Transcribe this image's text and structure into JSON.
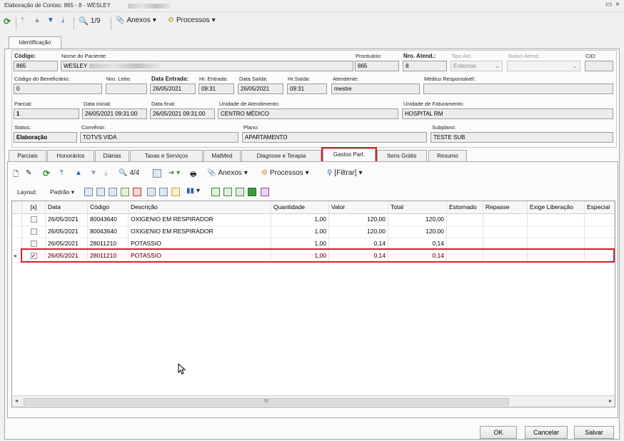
{
  "window": {
    "title": "Elaboração de Contas: 865 - 8 - WESLEY",
    "minimize": "▭",
    "close": "×"
  },
  "toolbar": {
    "record_pos": "1/9",
    "anexos": "Anexos",
    "processos": "Processos"
  },
  "outer_tab": "Identificação",
  "form": {
    "codigo_label": "Código:",
    "codigo": "865",
    "paciente_label": "Nome do Paciente:",
    "paciente": "WESLEY",
    "prontuario_label": "Prontuário:",
    "prontuario": "865",
    "nro_atend_label": "Nro. Atend.:",
    "nro_atend": "8",
    "tipo_atd_label": "Tipo Atd.:",
    "tipo_atd": "Externos",
    "status_atend_label": "Status Atend.:",
    "status_atend": "",
    "cid_label": "CID:",
    "cid": "",
    "cod_benef_label": "Código do Beneficiário:",
    "cod_benef": "0",
    "nro_leito_label": "Nro. Leito:",
    "nro_leito": "",
    "data_entrada_label": "Data Entrada:",
    "data_entrada": "26/05/2021",
    "hr_entrada_label": "Hr. Entrada:",
    "hr_entrada": "09:31",
    "data_saida_label": "Data Saída:",
    "data_saida": "26/05/2021",
    "hr_saida_label": "Hr.Saída:",
    "hr_saida": "09:31",
    "atendente_label": "Atendente:",
    "atendente": "mestre",
    "medico_label": "Médico Responsável:",
    "medico": "",
    "parcial_label": "Parcial:",
    "parcial": "1",
    "data_inicial_label": "Data inicial:",
    "data_inicial": "26/05/2021 09:31:00",
    "data_final_label": "Data final:",
    "data_final": "26/05/2021 09:31:00",
    "unid_atend_label": "Unidade de Atendimento:",
    "unid_atend": "CENTRO MÉDICO",
    "unid_fat_label": "Unidade de Faturamento:",
    "unid_fat": "HOSPITAL RM",
    "status_label": "Status:",
    "status": "Elaboração",
    "convenio_label": "Convênio:",
    "convenio": "TOTVS VIDA",
    "plano_label": "Plano:",
    "plano": "APARTAMENTO",
    "subplano_label": "Subplano:",
    "subplano": "TESTE SUB"
  },
  "tabs": [
    "Parciais",
    "Honorários",
    "Diárias",
    "Taxas e Serviços",
    "MatMed",
    "Diagnose e Terapia",
    "Gastos Part.",
    "Itens Grátis",
    "Resumo"
  ],
  "active_tab": "Gastos Part.",
  "inner_toolbar": {
    "record_pos": "4/4",
    "anexos": "Anexos",
    "processos": "Processos",
    "filtrar": "[Filtrar]"
  },
  "layout_bar": {
    "layout_label": "Layout:",
    "padrao": "Padrão"
  },
  "grid": {
    "columns": [
      "[x]",
      "Data",
      "Código",
      "Descrição",
      "Quantidade",
      "Valor",
      "Total",
      "Estornado",
      "Repasse",
      "Exige Liberação",
      "Especial"
    ],
    "rows": [
      {
        "checked": false,
        "data": "26/05/2021",
        "codigo": "80043640",
        "descricao": "OXIGENIO EM RESPIRADOR",
        "quantidade": "1,00",
        "valor": "120,00",
        "total": "120,00"
      },
      {
        "checked": false,
        "data": "26/05/2021",
        "codigo": "80043640",
        "descricao": "OXIGENIO EM RESPIRADOR",
        "quantidade": "1,00",
        "valor": "120,00",
        "total": "120,00"
      },
      {
        "checked": false,
        "data": "26/05/2021",
        "codigo": "28011210",
        "descricao": "POTASSIO",
        "quantidade": "1,00",
        "valor": "0,14",
        "total": "0,14"
      },
      {
        "checked": true,
        "data": "26/05/2021",
        "codigo": "28011210",
        "descricao": "POTASSIO",
        "quantidade": "1,00",
        "valor": "0,14",
        "total": "0,14"
      }
    ],
    "scroll_mid": "III"
  },
  "buttons": {
    "ok": "OK",
    "cancelar": "Cancelar",
    "salvar": "Salvar"
  },
  "colors": {
    "highlight": "#d9222a",
    "refresh_green": "#2e8b2e",
    "nav_blue": "#2b5fb3"
  }
}
